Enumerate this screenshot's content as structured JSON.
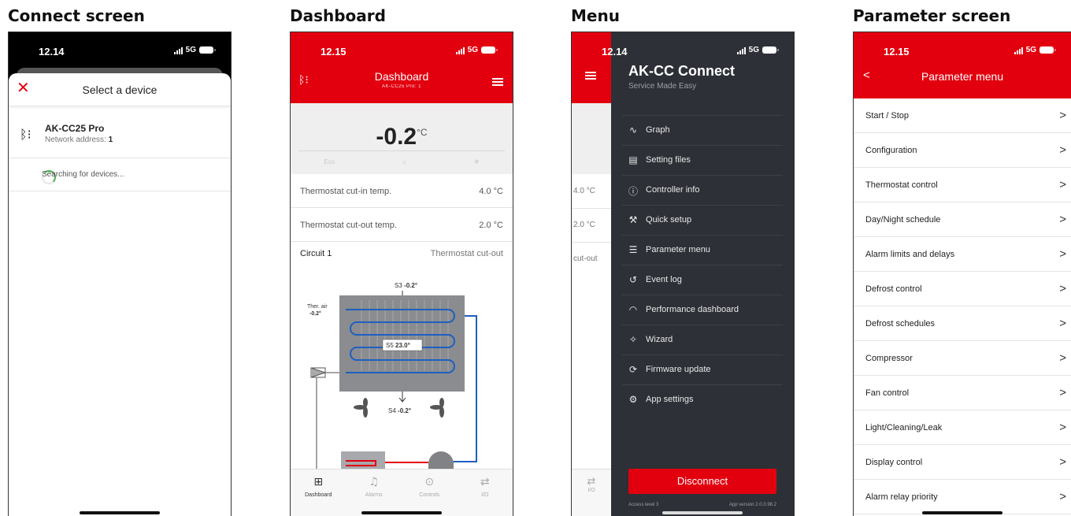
{
  "titles": {
    "connect": "Connect screen",
    "dashboard": "Dashboard",
    "menu": "Menu",
    "parameter": "Parameter screen"
  },
  "colors": {
    "brand_red": "#e2000f",
    "drawer_bg": "#2d3036",
    "spinner": "#4caf50"
  },
  "connect": {
    "status_time": "12.14",
    "network": "5G",
    "sheet_title": "Select a device",
    "close_icon": "close-icon",
    "device_name": "AK-CC25 Pro",
    "device_addr_label": "Network address:",
    "device_addr_value": "1",
    "searching": "Searching for devices..."
  },
  "dashboard": {
    "status_time": "12.15",
    "network": "5G",
    "title": "Dashboard",
    "subtitle": "AK-CC25 Pro: 1",
    "temperature": "-0.2",
    "temp_unit": "°C",
    "modes": [
      "Eco",
      "☼",
      "❄"
    ],
    "rows": [
      {
        "label": "Thermostat cut-in temp.",
        "value": "4.0 °C"
      },
      {
        "label": "Thermostat cut-out temp.",
        "value": "2.0 °C"
      }
    ],
    "circuit": {
      "label": "Circuit 1",
      "state": "Thermostat cut-out"
    },
    "sensors": {
      "s3_label": "S3",
      "s3_value": "-0.2°",
      "s5_label": "S5",
      "s5_value": "23.0°",
      "s4_label": "S4",
      "s4_value": "-0.2°",
      "air_label": "Ther. air",
      "air_value": "-0.2°"
    },
    "tabs": [
      {
        "icon": "grid-icon",
        "label": "Dashboard"
      },
      {
        "icon": "bell-icon",
        "label": "Alarms"
      },
      {
        "icon": "controls-icon",
        "label": "Controls"
      },
      {
        "icon": "arrows-icon",
        "label": "I/O"
      }
    ]
  },
  "menu": {
    "status_time": "12.14",
    "network": "5G",
    "app_name": "AK-CC Connect",
    "tagline": "Service Made Easy",
    "behind_values": [
      "4.0 °C",
      "2.0 °C",
      "cut-out"
    ],
    "behind_tab": "I/O",
    "items": [
      {
        "icon": "graph-icon",
        "label": "Graph"
      },
      {
        "icon": "file-icon",
        "label": "Setting files"
      },
      {
        "icon": "info-icon",
        "label": "Controller info"
      },
      {
        "icon": "wrench-icon",
        "label": "Quick setup"
      },
      {
        "icon": "list-icon",
        "label": "Parameter menu"
      },
      {
        "icon": "history-icon",
        "label": "Event log"
      },
      {
        "icon": "gauge-icon",
        "label": "Performance dashboard"
      },
      {
        "icon": "wand-icon",
        "label": "Wizard"
      },
      {
        "icon": "refresh-icon",
        "label": "Firmware update"
      },
      {
        "icon": "gear-icon",
        "label": "App settings"
      }
    ],
    "disconnect": "Disconnect",
    "access_level": "Access level 3",
    "app_version": "App version 2.0.0.98.2"
  },
  "parameter": {
    "status_time": "12.15",
    "network": "5G",
    "title": "Parameter menu",
    "items": [
      "Start / Stop",
      "Configuration",
      "Thermostat control",
      "Day/Night schedule",
      "Alarm limits and delays",
      "Defrost control",
      "Defrost schedules",
      "Compressor",
      "Fan control",
      "Light/Cleaning/Leak",
      "Display control",
      "Alarm relay priority"
    ]
  }
}
